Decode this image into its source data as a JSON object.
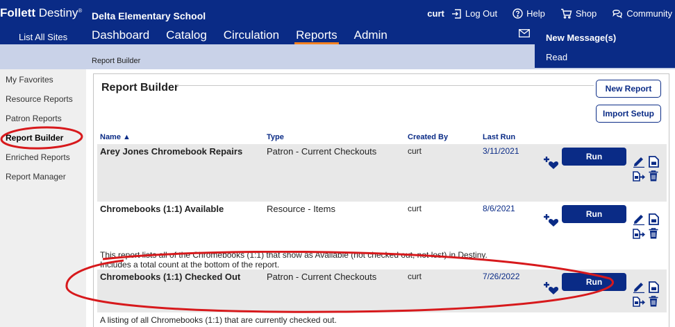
{
  "brand": {
    "name_bold": "Follett",
    "name_rest": " Destiny",
    "mark": "®"
  },
  "school": "Delta Elementary School",
  "list_all_sites": "List All Sites",
  "nav": {
    "tabs": [
      "Dashboard",
      "Catalog",
      "Circulation",
      "Reports",
      "Admin"
    ],
    "active": "Reports"
  },
  "user": {
    "name": "curt",
    "logout": "Log Out",
    "help": "Help",
    "shop": "Shop",
    "community": "Community"
  },
  "messages": {
    "new": "New Message(s)",
    "read": "Read"
  },
  "breadcrumb": "Report Builder",
  "sidebar": {
    "items": [
      "My Favorites",
      "Resource Reports",
      "Patron Reports",
      "Report Builder",
      "Enriched Reports",
      "Report Manager"
    ],
    "active": "Report Builder"
  },
  "page": {
    "title": "Report Builder",
    "new_report": "New Report",
    "import_setup": "Import Setup"
  },
  "table": {
    "headers": {
      "name": "Name ▲",
      "type": "Type",
      "created_by": "Created By",
      "last_run": "Last Run"
    },
    "rows": [
      {
        "name": "Arey Jones Chromebook Repairs",
        "type": "Patron - Current Checkouts",
        "created_by": "curt",
        "last_run": "3/11/2021",
        "run": "Run",
        "description": []
      },
      {
        "name": "Chromebooks (1:1) Available",
        "type": "Resource - Items",
        "created_by": "curt",
        "last_run": "8/6/2021",
        "run": "Run",
        "description": [
          "This report lists all of the Chromebooks (1:1) that show as Available (not checked out, not lost) in Destiny.",
          "Includes a total count at the bottom of the report."
        ]
      },
      {
        "name": "Chromebooks (1:1) Checked Out",
        "type": "Patron - Current Checkouts",
        "created_by": "curt",
        "last_run": "7/26/2022",
        "run": "Run",
        "description": [
          "A listing of all Chromebooks (1:1) that are currently checked out."
        ]
      }
    ]
  },
  "colors": {
    "navy": "#0a2b86",
    "accent": "#f58220",
    "subbar": "#c9d2e8",
    "annotation": "#d7191c"
  }
}
